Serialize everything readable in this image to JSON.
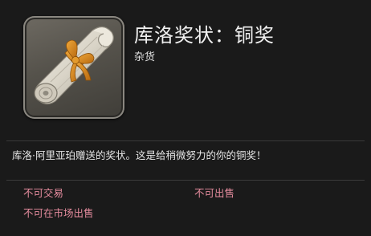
{
  "item": {
    "name": "库洛奖状：铜奖",
    "category": "杂货",
    "icon": "scroll-with-ribbon-icon",
    "description": "库洛·阿里亚珀赠送的奖状。这是给稍微努力的你的铜奖！"
  },
  "flags": [
    "不可交易",
    "不可出售",
    "不可在市场出售"
  ],
  "colors": {
    "background": "#1a1a1a",
    "restriction_text": "#e58c9e",
    "ribbon": "#d98a1e"
  }
}
